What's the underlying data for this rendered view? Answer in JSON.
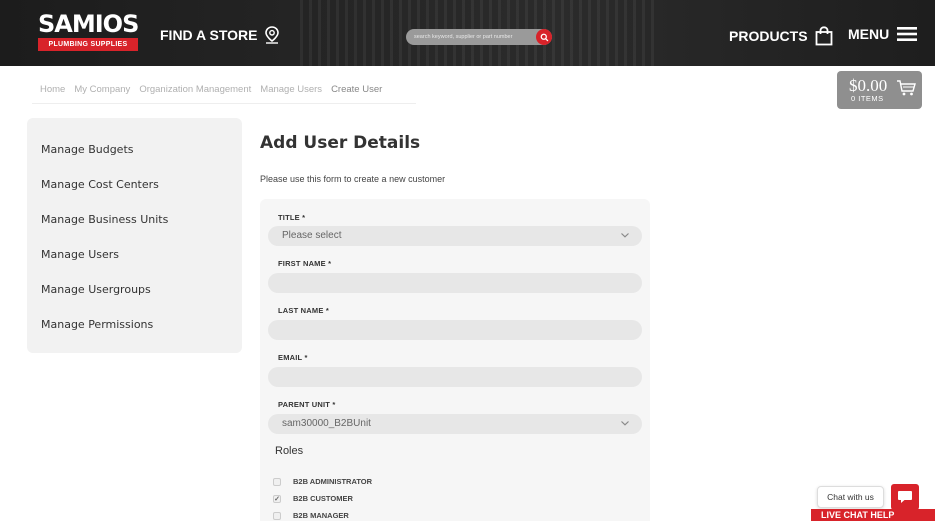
{
  "header": {
    "logo_top": "SAMIOS",
    "logo_bottom": "PLUMBING SUPPLIES",
    "find_store_label": "FIND A STORE",
    "search_placeholder": "search keyword, supplier or part number",
    "products_label": "PRODUCTS",
    "menu_label": "MENU"
  },
  "breadcrumb": [
    "Home",
    "My Company",
    "Organization Management",
    "Manage Users",
    "Create User"
  ],
  "cart": {
    "amount": "$0.00",
    "items": "0 ITEMS"
  },
  "sidebar": {
    "items": [
      {
        "label": "Manage Budgets"
      },
      {
        "label": "Manage Cost Centers"
      },
      {
        "label": "Manage Business Units"
      },
      {
        "label": "Manage Users"
      },
      {
        "label": "Manage Usergroups"
      },
      {
        "label": "Manage Permissions"
      }
    ]
  },
  "main": {
    "title": "Add User Details",
    "description": "Please use this form to create a new customer",
    "form": {
      "title_label": "TITLE *",
      "title_value": "Please select",
      "first_name_label": "FIRST NAME *",
      "first_name_value": "",
      "last_name_label": "LAST NAME *",
      "last_name_value": "",
      "email_label": "EMAIL *",
      "email_value": "",
      "parent_unit_label": "PARENT UNIT *",
      "parent_unit_value": "sam30000_B2BUnit",
      "roles_title": "Roles",
      "roles": [
        {
          "label": "B2B ADMINISTRATOR",
          "checked": false
        },
        {
          "label": "B2B CUSTOMER",
          "checked": true
        },
        {
          "label": "B2B MANAGER",
          "checked": false
        }
      ]
    }
  },
  "chat": {
    "bubble_text": "Chat with us",
    "banner_text": "LIVE CHAT HELP"
  },
  "colors": {
    "brand_red": "#d8232a",
    "header_dark": "#222222",
    "panel_gray": "#f2f2f2",
    "cart_gray": "#8f8f8f"
  }
}
